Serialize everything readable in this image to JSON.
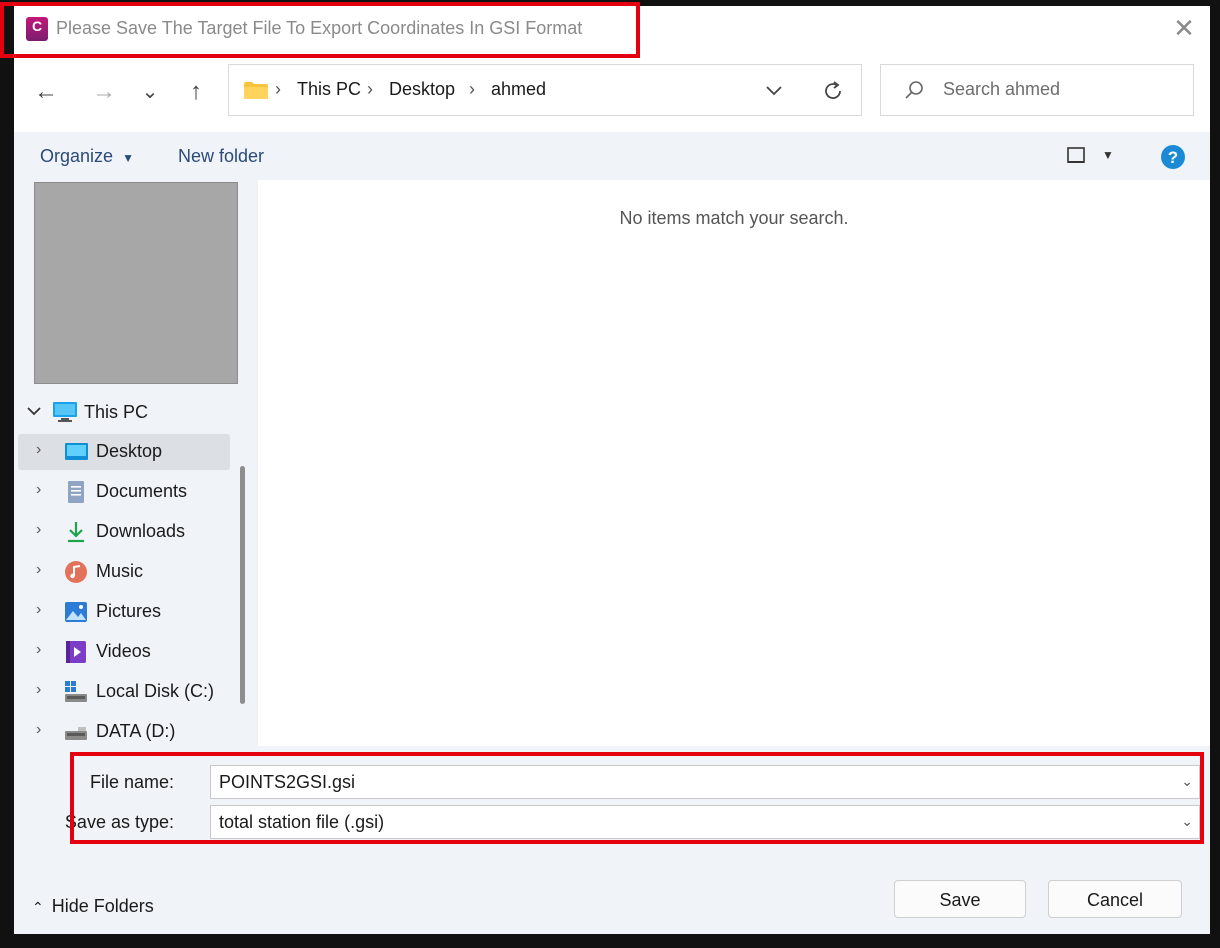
{
  "window": {
    "title": "Please Save The Target File To Export Coordinates In GSI Format",
    "app_icon_letter": "C",
    "close_glyph": "✕"
  },
  "nav": {
    "back": "←",
    "forward": "→",
    "recent": "⌄",
    "up": "↑",
    "breadcrumb": [
      "This PC",
      "Desktop",
      "ahmed"
    ],
    "separator": "›",
    "search_placeholder": "Search ahmed"
  },
  "toolbar": {
    "organize": "Organize",
    "new_folder": "New folder"
  },
  "main": {
    "empty_message": "No items match your search."
  },
  "tree": {
    "root": "This PC",
    "items": [
      {
        "label": "Desktop",
        "icon": "desktop-icon"
      },
      {
        "label": "Documents",
        "icon": "documents-icon"
      },
      {
        "label": "Downloads",
        "icon": "downloads-icon"
      },
      {
        "label": "Music",
        "icon": "music-icon"
      },
      {
        "label": "Pictures",
        "icon": "pictures-icon"
      },
      {
        "label": "Videos",
        "icon": "videos-icon"
      },
      {
        "label": "Local Disk (C:)",
        "icon": "local-disk-icon"
      },
      {
        "label": "DATA (D:)",
        "icon": "drive-icon"
      }
    ]
  },
  "form": {
    "file_name_label": "File name:",
    "file_name_value": "POINTS2GSI.gsi",
    "save_type_label": "Save as type:",
    "save_type_value": "total station file (.gsi)"
  },
  "footer": {
    "hide_folders": "Hide Folders",
    "save": "Save",
    "cancel": "Cancel"
  },
  "colors": {
    "highlight": "#e4000f",
    "accent": "#0067c0",
    "selected_row": "#dcdfe3"
  }
}
